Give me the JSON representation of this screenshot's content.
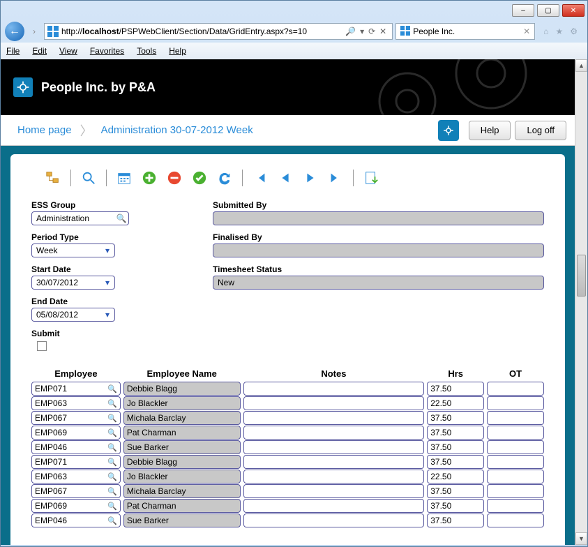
{
  "window": {
    "min": "–",
    "max": "▢",
    "close": "✕"
  },
  "browser": {
    "url_prefix": "http://",
    "url_host": "localhost",
    "url_path": "/PSPWebClient/Section/Data/GridEntry.aspx?s=10",
    "tab_title": "People Inc."
  },
  "menubar": {
    "file": "File",
    "edit": "Edit",
    "view": "View",
    "favorites": "Favorites",
    "tools": "Tools",
    "help": "Help"
  },
  "banner": {
    "title": "People Inc. by P&A"
  },
  "crumb": {
    "home": "Home page",
    "current": "Administration 30-07-2012 Week",
    "help": "Help",
    "logoff": "Log off"
  },
  "form": {
    "ess_group_label": "ESS Group",
    "ess_group_value": "Administration",
    "period_type_label": "Period Type",
    "period_type_value": "Week",
    "start_date_label": "Start Date",
    "start_date_value": "30/07/2012",
    "end_date_label": "End Date",
    "end_date_value": "05/08/2012",
    "submit_label": "Submit",
    "submitted_by_label": "Submitted By",
    "submitted_by_value": "",
    "finalised_by_label": "Finalised By",
    "finalised_by_value": "",
    "status_label": "Timesheet Status",
    "status_value": "New"
  },
  "grid": {
    "headers": {
      "employee": "Employee",
      "name": "Employee Name",
      "notes": "Notes",
      "hrs": "Hrs",
      "ot": "OT"
    },
    "rows": [
      {
        "emp": "EMP071",
        "name": "Debbie Blagg",
        "notes": "",
        "hrs": "37.50",
        "ot": ""
      },
      {
        "emp": "EMP063",
        "name": "Jo Blackler",
        "notes": "",
        "hrs": "22.50",
        "ot": ""
      },
      {
        "emp": "EMP067",
        "name": "Michala Barclay",
        "notes": "",
        "hrs": "37.50",
        "ot": ""
      },
      {
        "emp": "EMP069",
        "name": "Pat Charman",
        "notes": "",
        "hrs": "37.50",
        "ot": ""
      },
      {
        "emp": "EMP046",
        "name": "Sue Barker",
        "notes": "",
        "hrs": "37.50",
        "ot": ""
      },
      {
        "emp": "EMP071",
        "name": "Debbie Blagg",
        "notes": "",
        "hrs": "37.50",
        "ot": ""
      },
      {
        "emp": "EMP063",
        "name": "Jo Blackler",
        "notes": "",
        "hrs": "22.50",
        "ot": ""
      },
      {
        "emp": "EMP067",
        "name": "Michala Barclay",
        "notes": "",
        "hrs": "37.50",
        "ot": ""
      },
      {
        "emp": "EMP069",
        "name": "Pat Charman",
        "notes": "",
        "hrs": "37.50",
        "ot": ""
      },
      {
        "emp": "EMP046",
        "name": "Sue Barker",
        "notes": "",
        "hrs": "37.50",
        "ot": ""
      }
    ]
  }
}
